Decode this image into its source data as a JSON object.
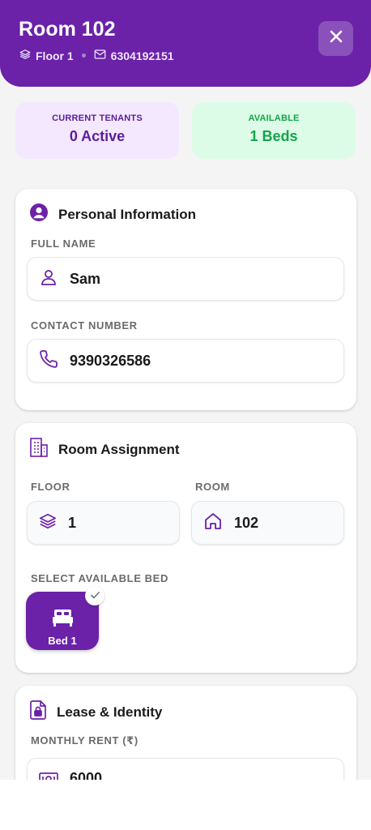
{
  "header": {
    "title": "Room 102",
    "floor": "Floor 1",
    "phone": "6304192151"
  },
  "stats": {
    "tenants_label": "CURRENT TENANTS",
    "tenants_value": "0 Active",
    "available_label": "AVAILABLE",
    "available_value": "1 Beds"
  },
  "personal": {
    "title": "Personal Information",
    "full_name_label": "FULL NAME",
    "full_name_value": "Sam",
    "contact_label": "CONTACT NUMBER",
    "contact_value": "9390326586"
  },
  "room": {
    "title": "Room Assignment",
    "floor_label": "FLOOR",
    "floor_value": "1",
    "room_label": "ROOM",
    "room_value": "102",
    "bed_label": "SELECT AVAILABLE BED",
    "beds": [
      {
        "label": "Bed 1",
        "selected": true
      }
    ]
  },
  "lease": {
    "title": "Lease & Identity",
    "rent_label": "MONTHLY RENT (₹)",
    "rent_value": "6000"
  },
  "colors": {
    "primary": "#6b21a8",
    "tenants_bg": "#f3e8fd",
    "available_bg": "#dcfce7",
    "available_text": "#16a34a"
  },
  "icons": [
    "layers-icon",
    "mail-icon",
    "close-icon",
    "user-circle-icon",
    "user-icon",
    "phone-icon",
    "building-icon",
    "home-icon",
    "bed-icon",
    "check-icon",
    "file-lock-icon",
    "banknote-icon"
  ]
}
